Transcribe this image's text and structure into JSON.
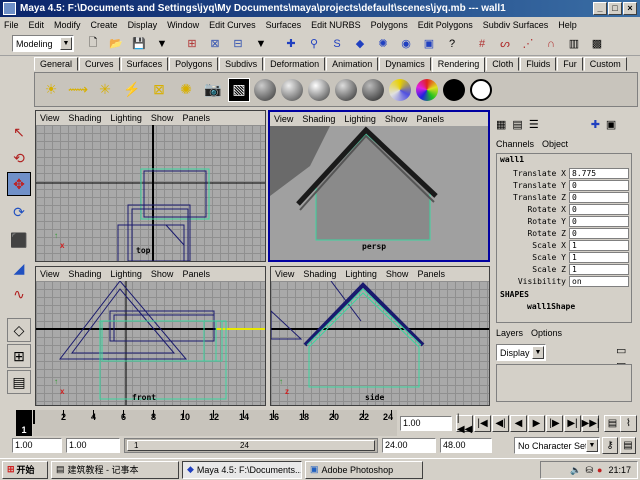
{
  "window": {
    "title": "Maya 4.5: F:\\Documents and Settings\\jyq\\My Documents\\maya\\projects\\default\\scenes\\jyq.mb  ---  wall1"
  },
  "menus": [
    "File",
    "Edit",
    "Modify",
    "Create",
    "Display",
    "Window",
    "Edit Curves",
    "Surfaces",
    "Edit NURBS",
    "Polygons",
    "Edit Polygons",
    "Subdiv Surfaces",
    "Help"
  ],
  "status_line": {
    "mode": "Modeling"
  },
  "shelf_tabs": [
    "General",
    "Curves",
    "Surfaces",
    "Polygons",
    "Subdivs",
    "Deformation",
    "Animation",
    "Dynamics",
    "Rendering",
    "Cloth",
    "Fluids",
    "Fur",
    "Custom"
  ],
  "active_shelf_tab": "Rendering",
  "viewport_menus": [
    "View",
    "Shading",
    "Lighting",
    "Show",
    "Panels"
  ],
  "viewports": [
    {
      "label": "top"
    },
    {
      "label": "persp"
    },
    {
      "label": "front"
    },
    {
      "label": "side"
    }
  ],
  "channel_box": {
    "tabs": [
      "Channels",
      "Object"
    ],
    "object_name": "wall1",
    "channels": [
      {
        "name": "Translate X",
        "value": "8.775"
      },
      {
        "name": "Translate Y",
        "value": "0"
      },
      {
        "name": "Translate Z",
        "value": "0"
      },
      {
        "name": "Rotate X",
        "value": "0"
      },
      {
        "name": "Rotate Y",
        "value": "0"
      },
      {
        "name": "Rotate Z",
        "value": "0"
      },
      {
        "name": "Scale X",
        "value": "1"
      },
      {
        "name": "Scale Y",
        "value": "1"
      },
      {
        "name": "Scale Z",
        "value": "1"
      },
      {
        "name": "Visibility",
        "value": "on"
      }
    ],
    "shapes_header": "SHAPES",
    "shape_name": "wall1Shape"
  },
  "layers": {
    "tabs": [
      "Layers",
      "Options"
    ],
    "display_value": "Display"
  },
  "time_slider": {
    "ticks": [
      "2",
      "4",
      "6",
      "8",
      "10",
      "12",
      "14",
      "16",
      "18",
      "20",
      "22",
      "24"
    ],
    "current_frame_marker": "1",
    "current_time": "1.00"
  },
  "range_slider": {
    "start_time": "1.00",
    "playback_start": "1.00",
    "range_start_label": "1",
    "range_end_label": "24",
    "playback_end": "24.00",
    "end_time": "48.00",
    "character_set": "No Character Set"
  },
  "taskbar": {
    "start_label": "开始",
    "items": [
      "建筑教程 - 记事本",
      "Maya 4.5: F:\\Documents...",
      "Adobe Photoshop"
    ],
    "clock": "21:17"
  },
  "colors": {
    "wire_blue": "#1a1a6e",
    "selected_green": "#3ad6a0",
    "axis_y": "#2c9a2c",
    "axis_x": "#d02020"
  }
}
